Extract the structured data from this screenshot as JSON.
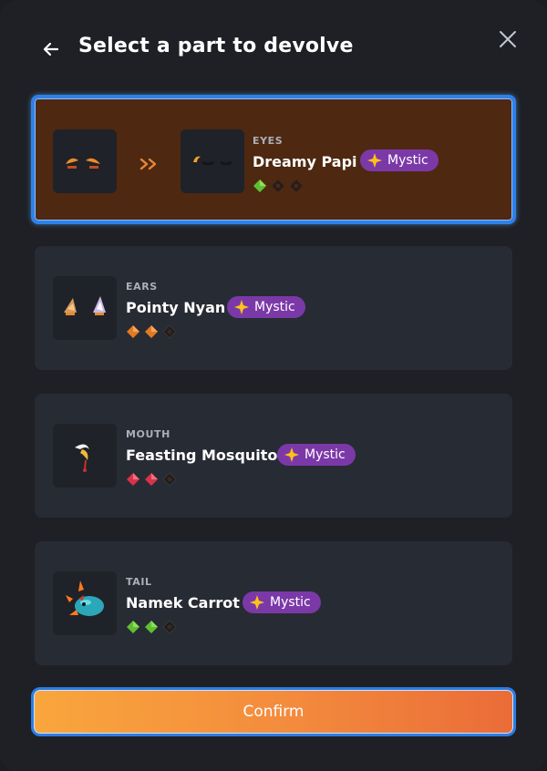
{
  "header": {
    "title": "Select a part to devolve",
    "back_icon": "arrow-left-icon",
    "close_icon": "close-icon"
  },
  "parts": [
    {
      "type": "EYES",
      "name": "Dreamy Papi",
      "badge": "Mystic",
      "gems": [
        "green",
        "empty",
        "empty"
      ],
      "selected": true
    },
    {
      "type": "EARS",
      "name": "Pointy Nyan",
      "badge": "Mystic",
      "gems": [
        "orange",
        "orange",
        "empty"
      ],
      "selected": false
    },
    {
      "type": "MOUTH",
      "name": "Feasting Mosquito",
      "badge": "Mystic",
      "gems": [
        "red",
        "red",
        "empty"
      ],
      "selected": false
    },
    {
      "type": "TAIL",
      "name": "Namek Carrot",
      "badge": "Mystic",
      "gems": [
        "green",
        "green",
        "empty"
      ],
      "selected": false
    }
  ],
  "confirm_label": "Confirm",
  "colors": {
    "background": "#1e2025",
    "card": "#272b34",
    "selected_card": "#4e2811",
    "selected_border": "#2f80e8",
    "badge": "#7b39a8",
    "confirm_start": "#f9a63d",
    "confirm_end": "#ea6c38"
  }
}
